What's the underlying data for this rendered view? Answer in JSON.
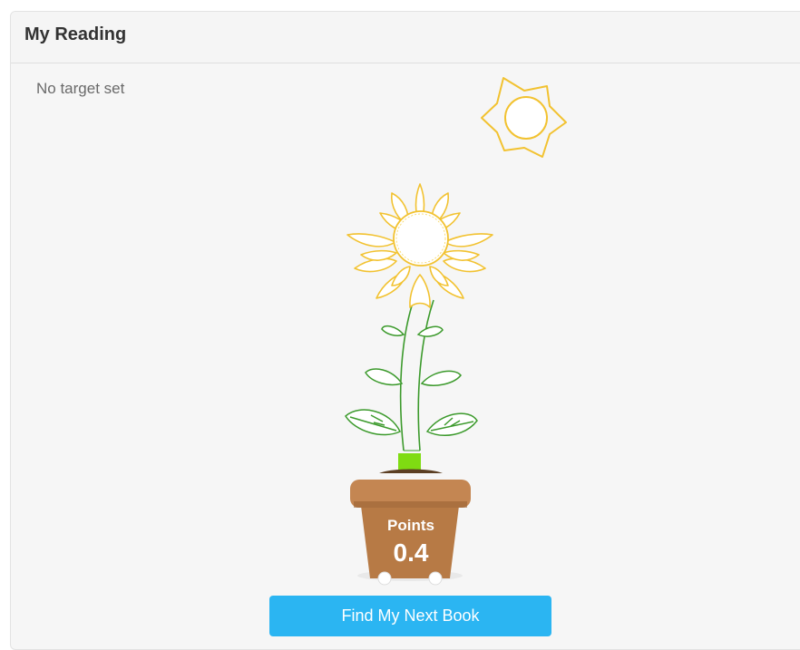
{
  "panel": {
    "title": "My Reading",
    "target_text": "No target set"
  },
  "plant": {
    "points_label": "Points",
    "points_value": "0.4",
    "petal_color": "#f2c230",
    "stem_color": "#3c9a2c",
    "pot_color": "#b77a45",
    "sprout_color": "#7fdc12"
  },
  "actions": {
    "find_button_label": "Find My Next Book"
  },
  "colors": {
    "accent": "#2bb5f2",
    "sun": "#f2c230"
  }
}
